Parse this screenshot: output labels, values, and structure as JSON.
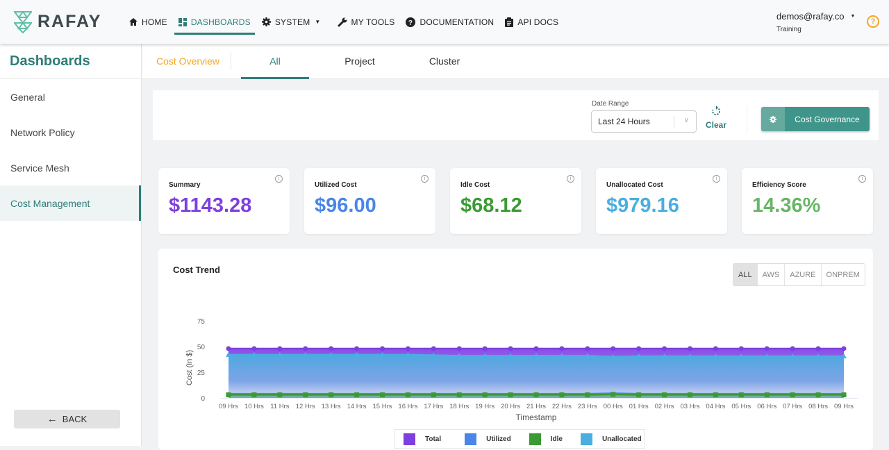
{
  "brand": {
    "name": "RAFAY"
  },
  "nav": {
    "items": [
      {
        "label": "HOME",
        "icon": "home-icon"
      },
      {
        "label": "DASHBOARDS",
        "icon": "dashboard-icon",
        "active": true
      },
      {
        "label": "SYSTEM",
        "icon": "gear-icon",
        "dropdown": true
      },
      {
        "label": "MY TOOLS",
        "icon": "wrench-icon"
      },
      {
        "label": "DOCUMENTATION",
        "icon": "help-circle-icon"
      },
      {
        "label": "API DOCS",
        "icon": "clipboard-icon"
      }
    ]
  },
  "user": {
    "email": "demos@rafay.co",
    "org": "Training",
    "help_icon": "?"
  },
  "sidebar": {
    "title": "Dashboards",
    "items": [
      {
        "label": "General"
      },
      {
        "label": "Network Policy"
      },
      {
        "label": "Service Mesh"
      },
      {
        "label": "Cost Management",
        "active": true
      }
    ],
    "back_label": "BACK"
  },
  "tabs": {
    "lead": "Cost Overview",
    "items": [
      {
        "label": "All",
        "active": true
      },
      {
        "label": "Project"
      },
      {
        "label": "Cluster"
      }
    ]
  },
  "filters": {
    "date_range_label": "Date Range",
    "date_range_value": "Last 24 Hours",
    "clear_label": "Clear",
    "governance_label": "Cost Governance"
  },
  "cards": [
    {
      "title": "Summary",
      "value": "$1143.28",
      "color": "#7e3fe0"
    },
    {
      "title": "Utilized Cost",
      "value": "$96.00",
      "color": "#4a86e8"
    },
    {
      "title": "Idle Cost",
      "value": "$68.12",
      "color": "#3b9a35"
    },
    {
      "title": "Unallocated Cost",
      "value": "$979.16",
      "color": "#4aaee0"
    },
    {
      "title": "Efficiency Score",
      "value": "14.36%",
      "color": "#67b666"
    }
  ],
  "cost_trend": {
    "title": "Cost Trend",
    "providers": [
      {
        "label": "ALL",
        "active": true
      },
      {
        "label": "AWS"
      },
      {
        "label": "AZURE"
      },
      {
        "label": "ONPREM"
      }
    ]
  },
  "chart_data": {
    "type": "area",
    "title": "Cost Trend",
    "xlabel": "Timestamp",
    "ylabel": "Cost (In $)",
    "ylim": [
      0,
      75
    ],
    "yticks": [
      0,
      25,
      50,
      75
    ],
    "grid": false,
    "legend_position": "bottom",
    "categories": [
      "09 Hrs",
      "10 Hrs",
      "11 Hrs",
      "12 Hrs",
      "13 Hrs",
      "14 Hrs",
      "15 Hrs",
      "16 Hrs",
      "17 Hrs",
      "18 Hrs",
      "19 Hrs",
      "20 Hrs",
      "21 Hrs",
      "22 Hrs",
      "23 Hrs",
      "00 Hrs",
      "01 Hrs",
      "02 Hrs",
      "03 Hrs",
      "04 Hrs",
      "05 Hrs",
      "06 Hrs",
      "07 Hrs",
      "08 Hrs",
      "09 Hrs"
    ],
    "series": [
      {
        "name": "Total",
        "color": "#7e3fe0",
        "marker": "circle",
        "values": [
          48,
          48,
          48,
          48,
          48,
          48,
          48,
          48,
          48,
          48,
          48,
          48,
          48,
          48,
          48,
          48,
          48,
          48,
          48,
          48,
          48,
          48,
          48,
          48,
          48
        ]
      },
      {
        "name": "Utilized",
        "color": "#4a86e8",
        "marker": "none",
        "values": [
          4,
          4,
          4,
          4,
          4,
          4,
          4,
          4,
          4,
          4,
          4,
          4,
          4,
          4,
          4,
          4.5,
          4,
          4,
          4,
          4,
          4,
          4,
          4,
          4,
          4
        ]
      },
      {
        "name": "Idle",
        "color": "#3b9a35",
        "marker": "square",
        "values": [
          3,
          3,
          3,
          3,
          3,
          3,
          3,
          3,
          3,
          3,
          3,
          3,
          3,
          3,
          3,
          3.5,
          3,
          3,
          3,
          3,
          3,
          3,
          3,
          3,
          3
        ]
      },
      {
        "name": "Unallocated",
        "color": "#4aaee0",
        "marker": "triangle",
        "values": [
          42,
          42,
          42,
          42,
          42,
          42,
          42,
          42,
          41.5,
          41,
          41,
          41,
          41,
          41,
          41,
          40,
          40.5,
          40.5,
          40.5,
          40.5,
          40.5,
          40.5,
          40.5,
          40.5,
          40.5
        ]
      }
    ]
  }
}
